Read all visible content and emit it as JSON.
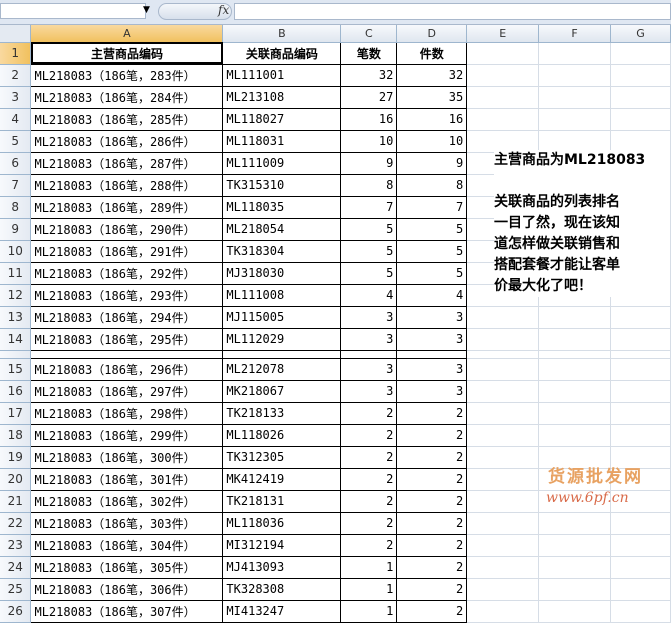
{
  "formula_bar": {
    "name_box": "",
    "fx_label": "fx",
    "formula": ""
  },
  "columns": [
    "A",
    "B",
    "C",
    "D",
    "E",
    "F",
    "G"
  ],
  "header_row": {
    "row": "1",
    "a": "主营商品编码",
    "b": "关联商品编码",
    "c": "笔数",
    "d": "件数"
  },
  "rows": [
    {
      "row": "2",
      "a": "ML218083（186笔，283件）",
      "b": "ML111001",
      "c": "32",
      "d": "32"
    },
    {
      "row": "3",
      "a": "ML218083（186笔，284件）",
      "b": "ML213108",
      "c": "27",
      "d": "35"
    },
    {
      "row": "4",
      "a": "ML218083（186笔，285件）",
      "b": "ML118027",
      "c": "16",
      "d": "16"
    },
    {
      "row": "5",
      "a": "ML218083（186笔，286件）",
      "b": "ML118031",
      "c": "10",
      "d": "10"
    },
    {
      "row": "6",
      "a": "ML218083（186笔，287件）",
      "b": "ML111009",
      "c": "9",
      "d": "9"
    },
    {
      "row": "7",
      "a": "ML218083（186笔，288件）",
      "b": "TK315310",
      "c": "8",
      "d": "8"
    },
    {
      "row": "8",
      "a": "ML218083（186笔，289件）",
      "b": "ML118035",
      "c": "7",
      "d": "7"
    },
    {
      "row": "9",
      "a": "ML218083（186笔，290件）",
      "b": "ML218054",
      "c": "5",
      "d": "5"
    },
    {
      "row": "10",
      "a": "ML218083（186笔，291件）",
      "b": "TK318304",
      "c": "5",
      "d": "5"
    },
    {
      "row": "11",
      "a": "ML218083（186笔，292件）",
      "b": "MJ318030",
      "c": "5",
      "d": "5"
    },
    {
      "row": "12",
      "a": "ML218083（186笔，293件）",
      "b": "ML111008",
      "c": "4",
      "d": "4"
    },
    {
      "row": "13",
      "a": "ML218083（186笔，294件）",
      "b": "MJ115005",
      "c": "3",
      "d": "3"
    },
    {
      "row": "14",
      "a": "ML218083（186笔，295件）",
      "b": "ML112029",
      "c": "3",
      "d": "3"
    },
    {
      "row": "15",
      "a": "ML218083（186笔，296件）",
      "b": "ML212078",
      "c": "3",
      "d": "3"
    },
    {
      "row": "16",
      "a": "ML218083（186笔，297件）",
      "b": "MK218067",
      "c": "3",
      "d": "3"
    },
    {
      "row": "17",
      "a": "ML218083（186笔，298件）",
      "b": "TK218133",
      "c": "2",
      "d": "2"
    },
    {
      "row": "18",
      "a": "ML218083（186笔，299件）",
      "b": "ML118026",
      "c": "2",
      "d": "2"
    },
    {
      "row": "19",
      "a": "ML218083（186笔，300件）",
      "b": "TK312305",
      "c": "2",
      "d": "2"
    },
    {
      "row": "20",
      "a": "ML218083（186笔，301件）",
      "b": "MK412419",
      "c": "2",
      "d": "2"
    },
    {
      "row": "21",
      "a": "ML218083（186笔，302件）",
      "b": "TK218131",
      "c": "2",
      "d": "2"
    },
    {
      "row": "22",
      "a": "ML218083（186笔，303件）",
      "b": "ML118036",
      "c": "2",
      "d": "2"
    },
    {
      "row": "23",
      "a": "ML218083（186笔，304件）",
      "b": "MI312194",
      "c": "2",
      "d": "2"
    },
    {
      "row": "24",
      "a": "ML218083（186笔，305件）",
      "b": "MJ413093",
      "c": "1",
      "d": "2"
    },
    {
      "row": "25",
      "a": "ML218083（186笔，306件）",
      "b": "TK328308",
      "c": "1",
      "d": "2"
    },
    {
      "row": "26",
      "a": "ML218083（186笔，307件）",
      "b": "MI413247",
      "c": "1",
      "d": "2"
    }
  ],
  "note": {
    "line1": "主营商品为ML218083",
    "line2": "关联商品的列表排名",
    "line3": "一目了然，现在该知",
    "line4": "道怎样做关联销售和",
    "line5": "搭配套餐才能让客单",
    "line6": "价最大化了吧！"
  },
  "watermark": {
    "site_name": "货源批发网",
    "url": "www.6pf.cn"
  },
  "colors": {
    "selected_header": "#f1c15f",
    "header_bg": "#dfe6ef",
    "grid_line": "#d6dde6",
    "watermark_cn": "#e8a262",
    "watermark_url": "#d96b4a"
  }
}
